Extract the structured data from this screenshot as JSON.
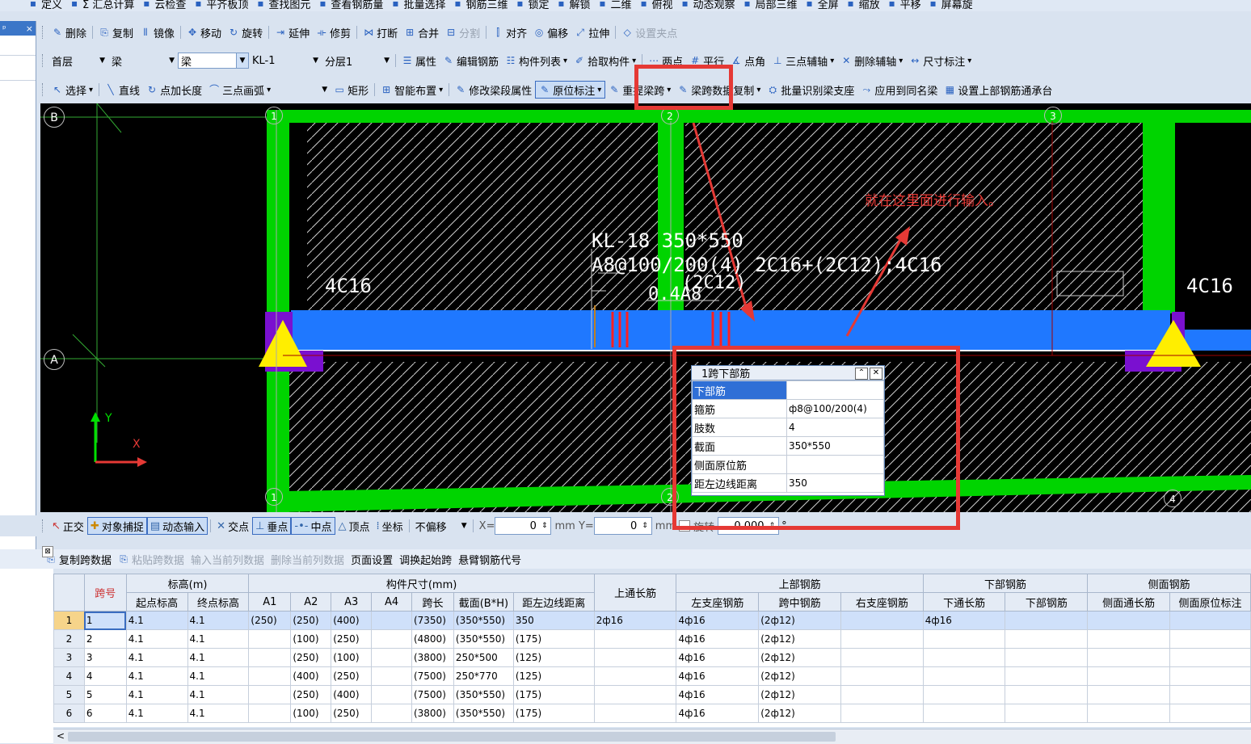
{
  "menu": {
    "items": [
      {
        "icon": "define-icon",
        "label": "定义"
      },
      {
        "icon": "sum-icon",
        "label": "Σ 汇总计算"
      },
      {
        "icon": "cloud-check-icon",
        "label": "云检查"
      },
      {
        "icon": "flat-plate-icon",
        "label": "平齐板顶"
      },
      {
        "icon": "find-icon",
        "label": "查找图元"
      },
      {
        "icon": "rebar-view-icon",
        "label": "查看钢筋量"
      },
      {
        "icon": "batch-select-icon",
        "label": "批量选择"
      },
      {
        "icon": "rebar-3d-icon",
        "label": "钢筋三维"
      },
      {
        "icon": "lock-icon",
        "label": "锁定"
      },
      {
        "icon": "unlock-icon",
        "label": "解锁"
      },
      {
        "icon": "2d-icon",
        "label": "二维"
      },
      {
        "icon": "top-view-icon",
        "label": "俯视"
      },
      {
        "icon": "dynamic-view-icon",
        "label": "动态观察"
      },
      {
        "icon": "local-3d-icon",
        "label": "局部三维"
      },
      {
        "icon": "fullscreen-icon",
        "label": "全屏"
      },
      {
        "icon": "zoom-icon",
        "label": "缩放"
      },
      {
        "icon": "pan-icon",
        "label": "平移"
      },
      {
        "icon": "screen-rotate-icon",
        "label": "屏幕旋"
      }
    ]
  },
  "left_panel": {
    "pin": "ᵖ",
    "close": "×"
  },
  "edit_toolbar": {
    "items": [
      {
        "label": "删除",
        "disabled": false
      },
      {
        "label": "复制",
        "disabled": false
      },
      {
        "label": "镜像",
        "disabled": false
      },
      {
        "label": "移动",
        "disabled": false
      },
      {
        "label": "旋转",
        "disabled": false
      },
      {
        "label": "延伸",
        "disabled": false
      },
      {
        "label": "修剪",
        "disabled": false
      },
      {
        "label": "打断",
        "disabled": false
      },
      {
        "label": "合并",
        "disabled": false
      },
      {
        "label": "分割",
        "disabled": true
      },
      {
        "label": "对齐",
        "disabled": false
      },
      {
        "label": "偏移",
        "disabled": false
      },
      {
        "label": "拉伸",
        "disabled": false
      },
      {
        "label": "设置夹点",
        "disabled": true
      }
    ]
  },
  "layer_toolbar": {
    "floor": "首层",
    "category": "梁",
    "type": "梁",
    "component": "KL-1",
    "sublayer": "分层1",
    "items": [
      "属性",
      "编辑钢筋",
      "构件列表",
      "拾取构件",
      "两点",
      "平行",
      "点角",
      "三点辅轴",
      "删除辅轴",
      "尺寸标注"
    ]
  },
  "draw_toolbar": {
    "items": [
      "选择",
      "直线",
      "点加长度",
      "三点画弧",
      "矩形",
      "智能布置",
      "修改梁段属性",
      "原位标注",
      "重提梁跨",
      "梁跨数据复制",
      "批量识别梁支座",
      "应用到同名梁",
      "设置上部钢筋通承台"
    ]
  },
  "canvas": {
    "axis_labels": {
      "B": "B",
      "A": "A",
      "n1": "1",
      "n2": "2",
      "n3": "3",
      "n4": "4"
    },
    "beam_annotation_line1": "KL-18 350*550",
    "beam_annotation_line2": "A8@100/200(4)  2C16+(2C12);4C16",
    "beam_annotation_line3": "(2C12)",
    "beam_annotation_line4": "0.4A8",
    "left_rebar": "4C16",
    "right_rebar": "4C16",
    "note": "就在这里面进行输入。",
    "ucs_x": "X",
    "ucs_y": "Y",
    "colors": {
      "beam": "#1f78ff",
      "column": "#00e000",
      "support": "#ffee00",
      "highlight": "#e53935"
    }
  },
  "popup": {
    "title": "1跨下部筋",
    "rows": [
      {
        "key": "下部筋",
        "value": ""
      },
      {
        "key": "箍筋",
        "value": "ф8@100/200(4)"
      },
      {
        "key": "肢数",
        "value": "4"
      },
      {
        "key": "截面",
        "value": "350*550"
      },
      {
        "key": "侧面原位筋",
        "value": ""
      },
      {
        "key": "距左边线距离",
        "value": "350"
      }
    ]
  },
  "snap_bar": {
    "ortho": "正交",
    "object_snap": "对象捕捉",
    "dynamic_input": "动态输入",
    "intersection": "交点",
    "perpendicular": "垂点",
    "midpoint": "中点",
    "vertex": "顶点",
    "coordinate": "坐标",
    "offset_mode": "不偏移",
    "x_label": "X=",
    "x_value": "0",
    "y_label": "mm Y=",
    "y_value": "0",
    "mm": "mm",
    "rotate_label": "旋转",
    "rotate_value": "0.000",
    "deg": "°"
  },
  "grid_toolbar": {
    "items": [
      {
        "label": "复制跨数据",
        "disabled": false
      },
      {
        "label": "粘贴跨数据",
        "disabled": true
      },
      {
        "label": "输入当前列数据",
        "disabled": true
      },
      {
        "label": "删除当前列数据",
        "disabled": true
      },
      {
        "label": "页面设置",
        "disabled": false
      },
      {
        "label": "调换起始跨",
        "disabled": false
      },
      {
        "label": "悬臂钢筋代号",
        "disabled": false
      }
    ]
  },
  "table": {
    "group_headers": {
      "span": "跨号",
      "elevation": "标高(m)",
      "dims": "构件尺寸(mm)",
      "top_through": "上通长筋",
      "top_rebar": "上部钢筋",
      "bottom_rebar": "下部钢筋",
      "side_rebar": "侧面钢筋"
    },
    "columns": [
      "起点标高",
      "终点标高",
      "A1",
      "A2",
      "A3",
      "A4",
      "跨长",
      "截面(B*H)",
      "距左边线距离",
      "左支座钢筋",
      "跨中钢筋",
      "右支座钢筋",
      "下通长筋",
      "下部钢筋",
      "侧面通长筋",
      "侧面原位标注"
    ],
    "rows": [
      {
        "n": "1",
        "span": "1",
        "start": "4.1",
        "end": "4.1",
        "a1": "(250)",
        "a2": "(250)",
        "a3": "(400)",
        "a4": "",
        "len": "(7350)",
        "sec": "(350*550)",
        "dist": "350",
        "top": "2ф16",
        "left": "4ф16",
        "mid": "(2ф12)",
        "right": "",
        "bthrough": "4ф16",
        "bottom": "",
        "sthrough": "",
        "sorig": ""
      },
      {
        "n": "2",
        "span": "2",
        "start": "4.1",
        "end": "4.1",
        "a1": "",
        "a2": "(100)",
        "a3": "(250)",
        "a4": "",
        "len": "(4800)",
        "sec": "(350*550)",
        "dist": "(175)",
        "top": "",
        "left": "4ф16",
        "mid": "(2ф12)",
        "right": "",
        "bthrough": "",
        "bottom": "",
        "sthrough": "",
        "sorig": ""
      },
      {
        "n": "3",
        "span": "3",
        "start": "4.1",
        "end": "4.1",
        "a1": "",
        "a2": "(250)",
        "a3": "(100)",
        "a4": "",
        "len": "(3800)",
        "sec": "250*500",
        "dist": "(125)",
        "top": "",
        "left": "4ф16",
        "mid": "(2ф12)",
        "right": "",
        "bthrough": "",
        "bottom": "",
        "sthrough": "",
        "sorig": ""
      },
      {
        "n": "4",
        "span": "4",
        "start": "4.1",
        "end": "4.1",
        "a1": "",
        "a2": "(400)",
        "a3": "(250)",
        "a4": "",
        "len": "(7500)",
        "sec": "250*770",
        "dist": "(125)",
        "top": "",
        "left": "4ф16",
        "mid": "(2ф12)",
        "right": "",
        "bthrough": "",
        "bottom": "",
        "sthrough": "",
        "sorig": ""
      },
      {
        "n": "5",
        "span": "5",
        "start": "4.1",
        "end": "4.1",
        "a1": "",
        "a2": "(250)",
        "a3": "(400)",
        "a4": "",
        "len": "(7500)",
        "sec": "(350*550)",
        "dist": "(175)",
        "top": "",
        "left": "4ф16",
        "mid": "(2ф12)",
        "right": "",
        "bthrough": "",
        "bottom": "",
        "sthrough": "",
        "sorig": ""
      },
      {
        "n": "6",
        "span": "6",
        "start": "4.1",
        "end": "4.1",
        "a1": "",
        "a2": "(100)",
        "a3": "(250)",
        "a4": "",
        "len": "(3800)",
        "sec": "(350*550)",
        "dist": "(175)",
        "top": "",
        "left": "4ф16",
        "mid": "(2ф12)",
        "right": "",
        "bthrough": "",
        "bottom": "",
        "sthrough": "",
        "sorig": ""
      }
    ]
  },
  "scrollbar": {
    "left_arrow": "<"
  }
}
